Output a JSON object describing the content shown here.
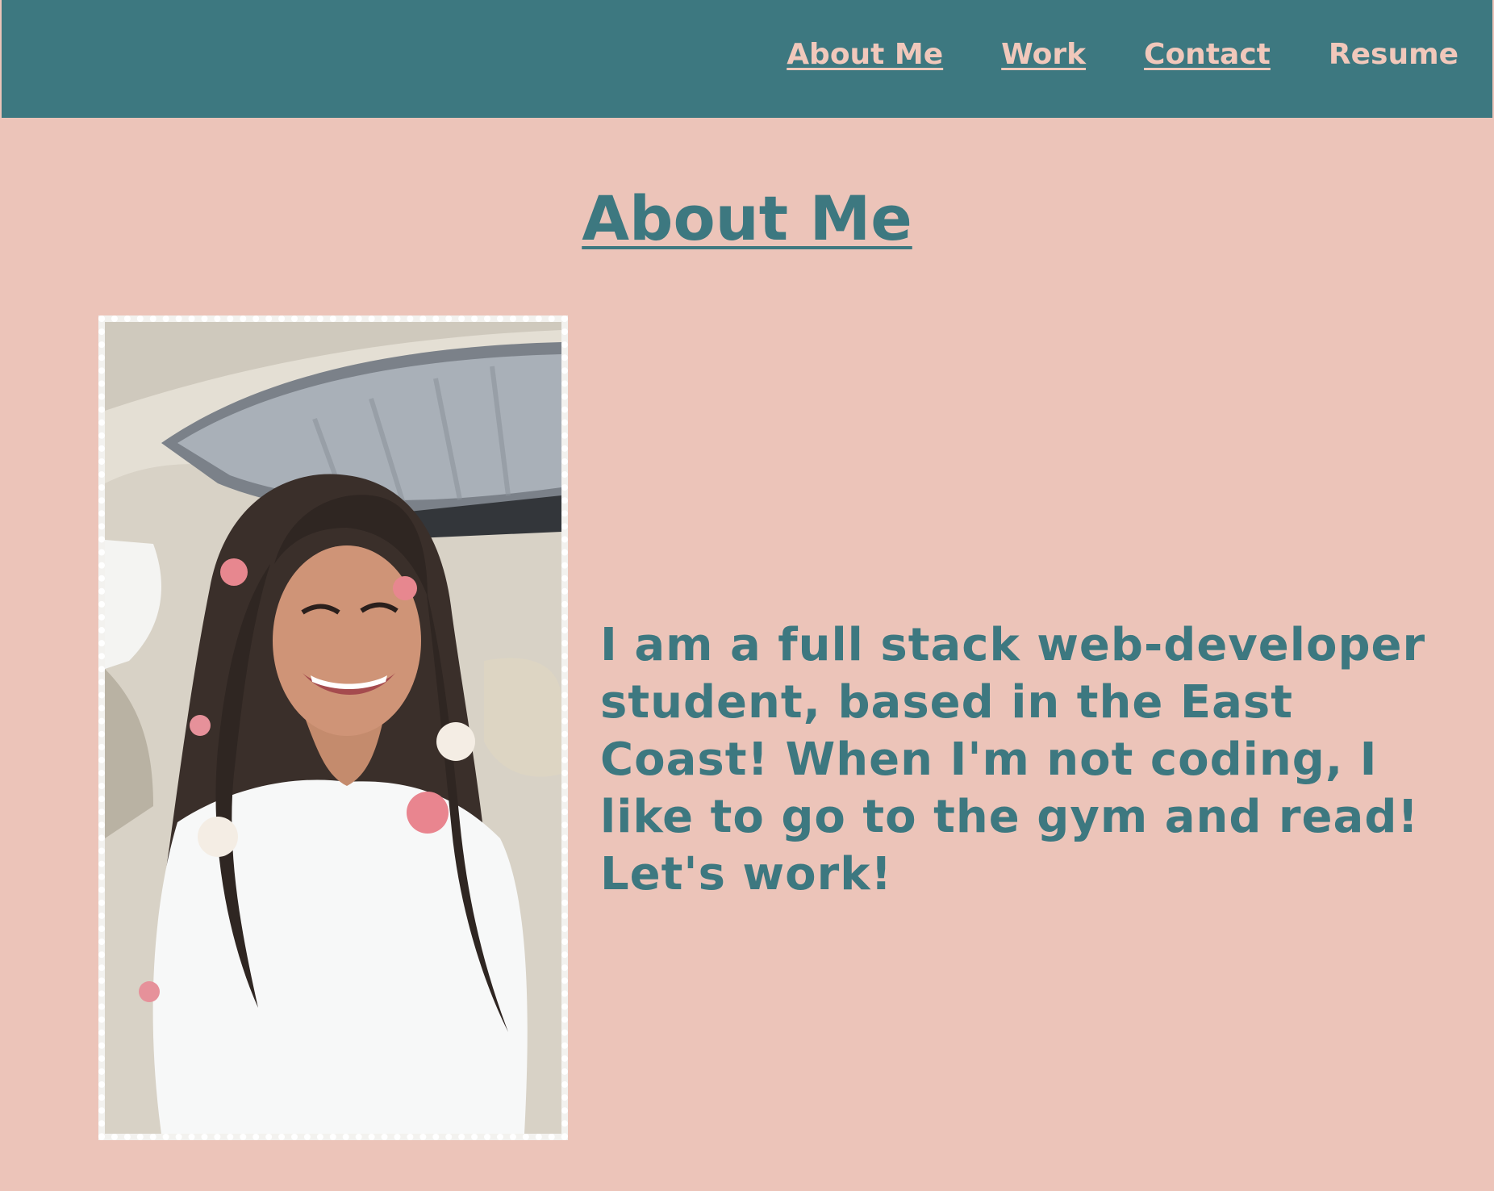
{
  "nav": {
    "items": [
      {
        "label": "About Me"
      },
      {
        "label": "Work"
      },
      {
        "label": "Contact"
      },
      {
        "label": "Resume"
      }
    ]
  },
  "about": {
    "title": "About Me",
    "bio": "I am a full stack web-developer student, based in the East Coast! When I'm not coding, I like to go to the gym and read! Let's work!"
  },
  "colors": {
    "background": "#ecc4b9",
    "navbar": "#3d7880",
    "nav_text": "#f1c8bb",
    "accent_text": "#3d7880",
    "photo_border": "#ffffff"
  }
}
